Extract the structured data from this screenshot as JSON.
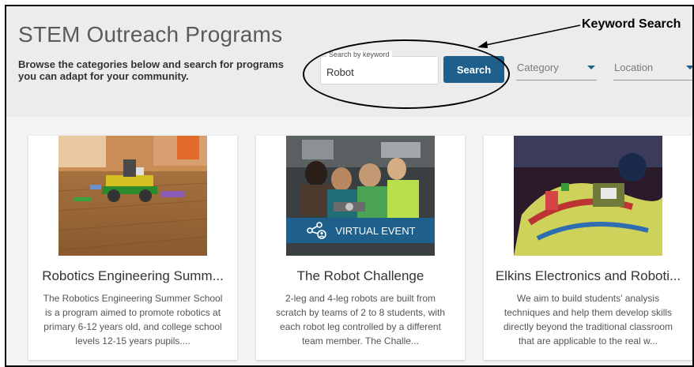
{
  "header": {
    "title": "STEM Outreach Programs",
    "subtitle": "Browse the categories below and search for programs you can adapt for your community."
  },
  "search": {
    "legend": "Search by keyword",
    "value": "Robot",
    "button_label": "Search"
  },
  "filters": {
    "category_label": "Category",
    "location_label": "Location"
  },
  "annotation": {
    "label": "Keyword Search"
  },
  "cards": [
    {
      "title": "Robotics Engineering Summ...",
      "description": "The Robotics Engineering Summer School is a program aimed to promote robotics at primary 6-12 years old, and college school levels 12-15 years pupils...."
    },
    {
      "title": "The Robot Challenge",
      "badge": "VIRTUAL EVENT",
      "description": "2-leg and 4-leg robots are built from scratch by teams of 2 to 8 students, with each robot leg controlled by a different team member. The Challe..."
    },
    {
      "title": "Elkins Electronics and Roboti...",
      "description": "We aim to build students' analysis techniques and help them develop skills directly beyond the traditional classroom that are applicable to the real w..."
    }
  ],
  "colors": {
    "accent": "#1f5f8b",
    "header_bg": "#ececec",
    "page_bg": "#f3f3f3"
  },
  "icons": {
    "virtual_event": "share-person-icon",
    "dropdown": "caret-down-icon"
  }
}
